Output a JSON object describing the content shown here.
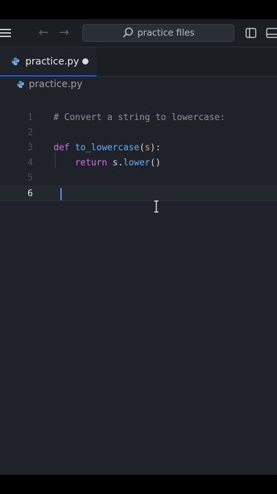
{
  "window": {
    "search_placeholder": "practice files"
  },
  "tabs": [
    {
      "label": "practice.py",
      "modified": true
    }
  ],
  "breadcrumb": {
    "file": "practice.py"
  },
  "editor": {
    "active_line": 6,
    "lines": [
      {
        "number": "1",
        "tokens": [
          {
            "t": "comment",
            "v": "# Convert a string to lowercase:"
          }
        ]
      },
      {
        "number": "2",
        "tokens": []
      },
      {
        "number": "3",
        "tokens": [
          {
            "t": "kw",
            "v": "def"
          },
          {
            "t": "punct",
            "v": " "
          },
          {
            "t": "fn",
            "v": "to_lowercase"
          },
          {
            "t": "punct",
            "v": "("
          },
          {
            "t": "param",
            "v": "s"
          },
          {
            "t": "punct",
            "v": "):"
          }
        ]
      },
      {
        "number": "4",
        "tokens": [
          {
            "t": "punct",
            "v": "    "
          },
          {
            "t": "kw",
            "v": "return"
          },
          {
            "t": "punct",
            "v": " s."
          },
          {
            "t": "fn",
            "v": "lower"
          },
          {
            "t": "punct",
            "v": "()"
          }
        ]
      },
      {
        "number": "5",
        "tokens": []
      },
      {
        "number": "6",
        "tokens": []
      }
    ]
  },
  "colors": {
    "accent": "#3b82f6",
    "keyword": "#c678dd",
    "function": "#61afef",
    "param": "#e5a66a",
    "comment": "#8b929a"
  },
  "icons": {
    "menu": "hamburger-icon",
    "back": "arrow-left-icon",
    "forward": "arrow-right-icon",
    "search": "search-icon",
    "layout": "split-layout-icon",
    "panel": "panel-icon",
    "file": "python-file-icon"
  }
}
